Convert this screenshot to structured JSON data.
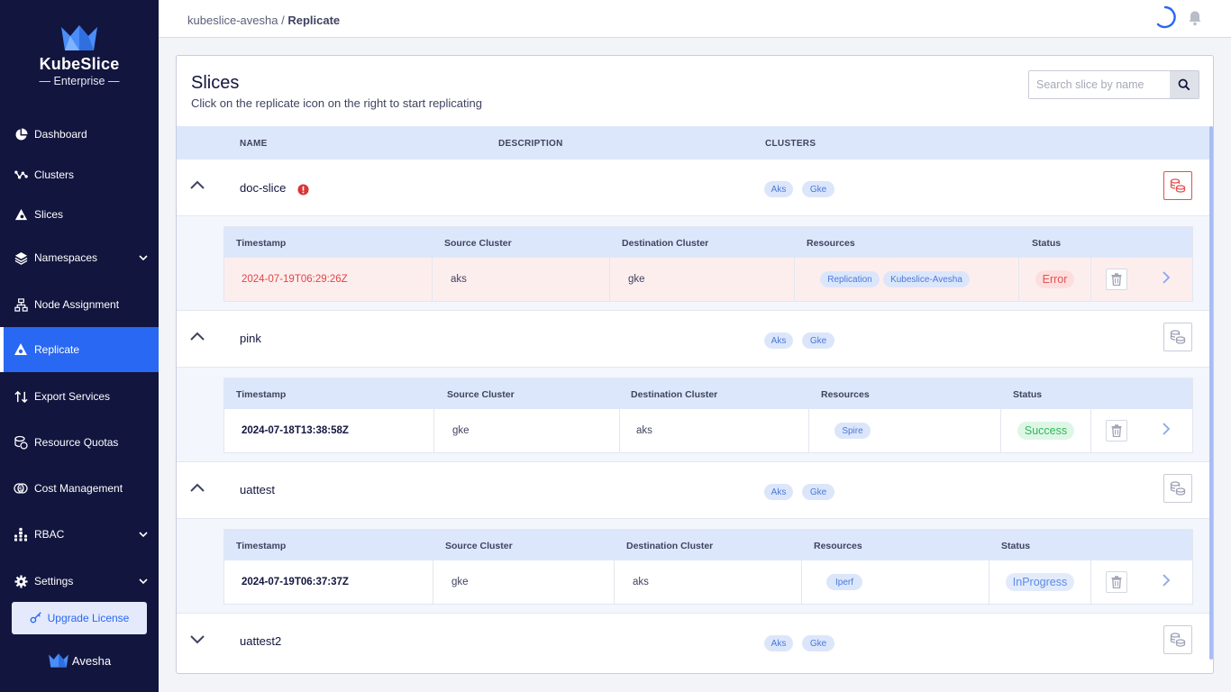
{
  "sidebar": {
    "logo_name": "KubeSlice",
    "logo_sub": "Enterprise",
    "items": [
      {
        "label": "Dashboard"
      },
      {
        "label": "Clusters"
      },
      {
        "label": "Slices"
      },
      {
        "label": "Namespaces"
      },
      {
        "label": "Node Assignment"
      },
      {
        "label": "Replicate"
      },
      {
        "label": "Export Services"
      },
      {
        "label": "Resource Quotas"
      },
      {
        "label": "Cost Management"
      },
      {
        "label": "RBAC"
      },
      {
        "label": "Settings"
      }
    ],
    "active_item": "Replicate",
    "upgrade_label": "Upgrade License",
    "footer_brand": "Avesha"
  },
  "header": {
    "breadcrumb_parent": "kubeslice-avesha",
    "breadcrumb_sep": "/",
    "breadcrumb_current": "Replicate"
  },
  "card": {
    "title": "Slices",
    "subtitle": "Click on the replicate icon on the right to start replicating",
    "search_placeholder": "Search slice by name",
    "columns": {
      "name": "NAME",
      "description": "DESCRIPTION",
      "clusters": "CLUSTERS"
    }
  },
  "sub_columns": {
    "timestamp": "Timestamp",
    "source": "Source Cluster",
    "destination": "Destination Cluster",
    "resources": "Resources",
    "status": "Status"
  },
  "slices": [
    {
      "name": "doc-slice",
      "has_error": true,
      "clusters": [
        "Aks",
        "Gke"
      ],
      "expanded": true,
      "replication": {
        "timestamp": "2024-07-19T06:29:26Z",
        "source": "aks",
        "destination": "gke",
        "resources": [
          "Replication",
          "Kubeslice-Avesha"
        ],
        "status": "Error"
      }
    },
    {
      "name": "pink",
      "has_error": false,
      "clusters": [
        "Aks",
        "Gke"
      ],
      "expanded": true,
      "replication": {
        "timestamp": "2024-07-18T13:38:58Z",
        "source": "gke",
        "destination": "aks",
        "resources": [
          "Spire"
        ],
        "status": "Success"
      }
    },
    {
      "name": "uattest",
      "has_error": false,
      "clusters": [
        "Aks",
        "Gke"
      ],
      "expanded": true,
      "replication": {
        "timestamp": "2024-07-19T06:37:37Z",
        "source": "gke",
        "destination": "aks",
        "resources": [
          "Iperf"
        ],
        "status": "InProgress"
      }
    },
    {
      "name": "uattest2",
      "has_error": false,
      "clusters": [
        "Aks",
        "Gke"
      ],
      "expanded": false
    }
  ],
  "colors": {
    "sidebar_bg": "#12153e",
    "accent": "#2868f3",
    "error": "#e05353",
    "success": "#2eb85c",
    "progress": "#5e8ae5"
  }
}
